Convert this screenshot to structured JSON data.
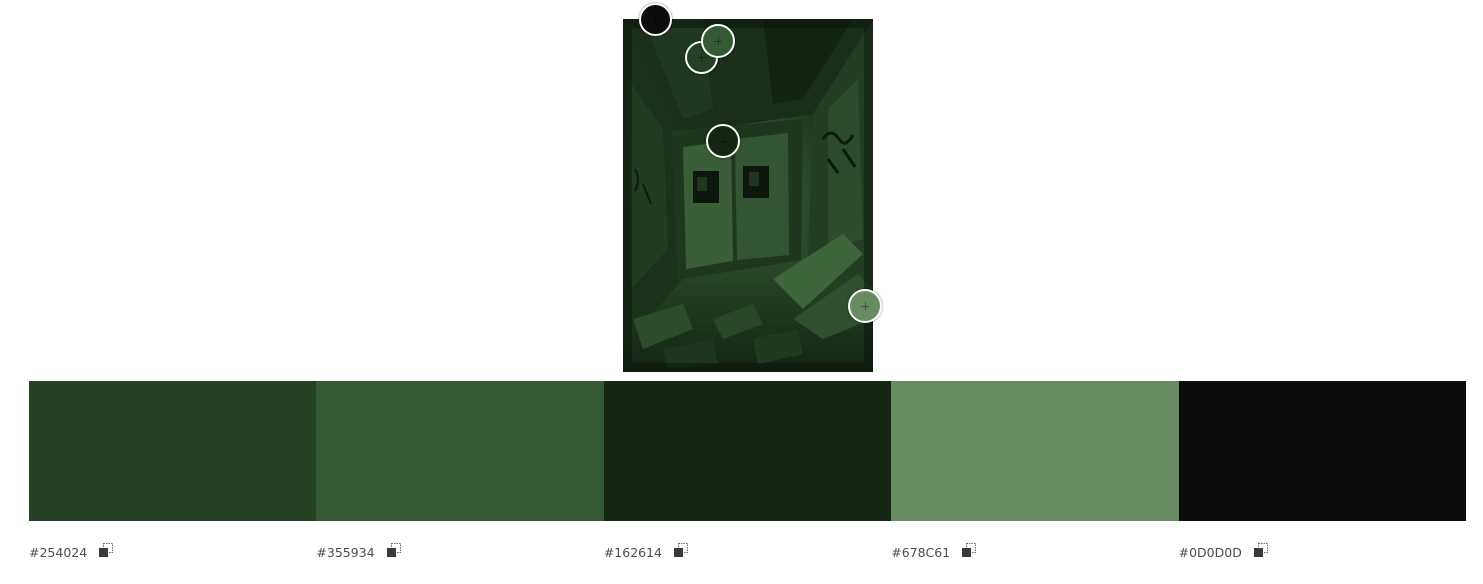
{
  "image": {
    "description_icon": "photo-thumbnail"
  },
  "pickers": [
    {
      "color": "#0D0D0D",
      "icon": "color-picker-icon"
    },
    {
      "color": "#254024",
      "icon": "color-picker-icon"
    },
    {
      "color": "#355934",
      "icon": "color-picker-icon"
    },
    {
      "color": "#162614",
      "icon": "color-picker-icon"
    },
    {
      "color": "#678C61",
      "icon": "color-picker-icon"
    }
  ],
  "palette": [
    {
      "hex": "#254024",
      "color": "#254024",
      "copy_icon": "copy-icon"
    },
    {
      "hex": "#355934",
      "color": "#355934",
      "copy_icon": "copy-icon"
    },
    {
      "hex": "#162614",
      "color": "#162614",
      "copy_icon": "copy-icon"
    },
    {
      "hex": "#678C61",
      "color": "#678C61",
      "copy_icon": "copy-icon"
    },
    {
      "hex": "#0D0D0D",
      "color": "#0D0D0D",
      "copy_icon": "copy-icon"
    }
  ]
}
